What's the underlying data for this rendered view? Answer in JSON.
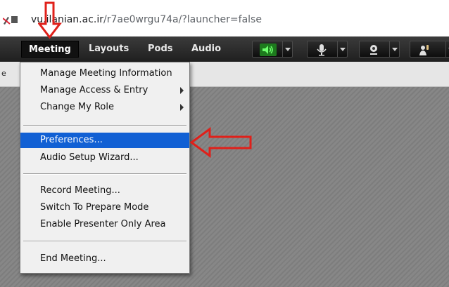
{
  "browser": {
    "url_host": "vu.ilanian.ac.ir",
    "url_path": "/r7ae0wrgu74a/?launcher=false"
  },
  "menubar": {
    "items": [
      {
        "label": "Meeting"
      },
      {
        "label": "Layouts"
      },
      {
        "label": "Pods"
      },
      {
        "label": "Audio"
      }
    ],
    "controls": [
      {
        "icon": "speaker-icon",
        "active_color": "#28c628"
      },
      {
        "icon": "microphone-icon"
      },
      {
        "icon": "webcam-icon"
      },
      {
        "icon": "raise-hand-icon"
      }
    ]
  },
  "tabrow": {
    "stub_text": "e"
  },
  "meeting_menu": {
    "items": [
      {
        "label": "Manage Meeting Information",
        "submenu": false
      },
      {
        "label": "Manage Access & Entry",
        "submenu": true
      },
      {
        "label": "Change My Role",
        "submenu": true
      },
      {
        "label": "Preferences...",
        "selected": true
      },
      {
        "label": "Audio Setup Wizard..."
      },
      {
        "label": "Record Meeting..."
      },
      {
        "label": "Switch To Prepare Mode"
      },
      {
        "label": "Enable Presenter Only Area"
      },
      {
        "label": "End Meeting..."
      }
    ]
  },
  "colors": {
    "selection": "#1160d4",
    "annotation": "#e0201a",
    "menubar": "#2a2a2a",
    "menu_bg": "#f0f0f0"
  }
}
